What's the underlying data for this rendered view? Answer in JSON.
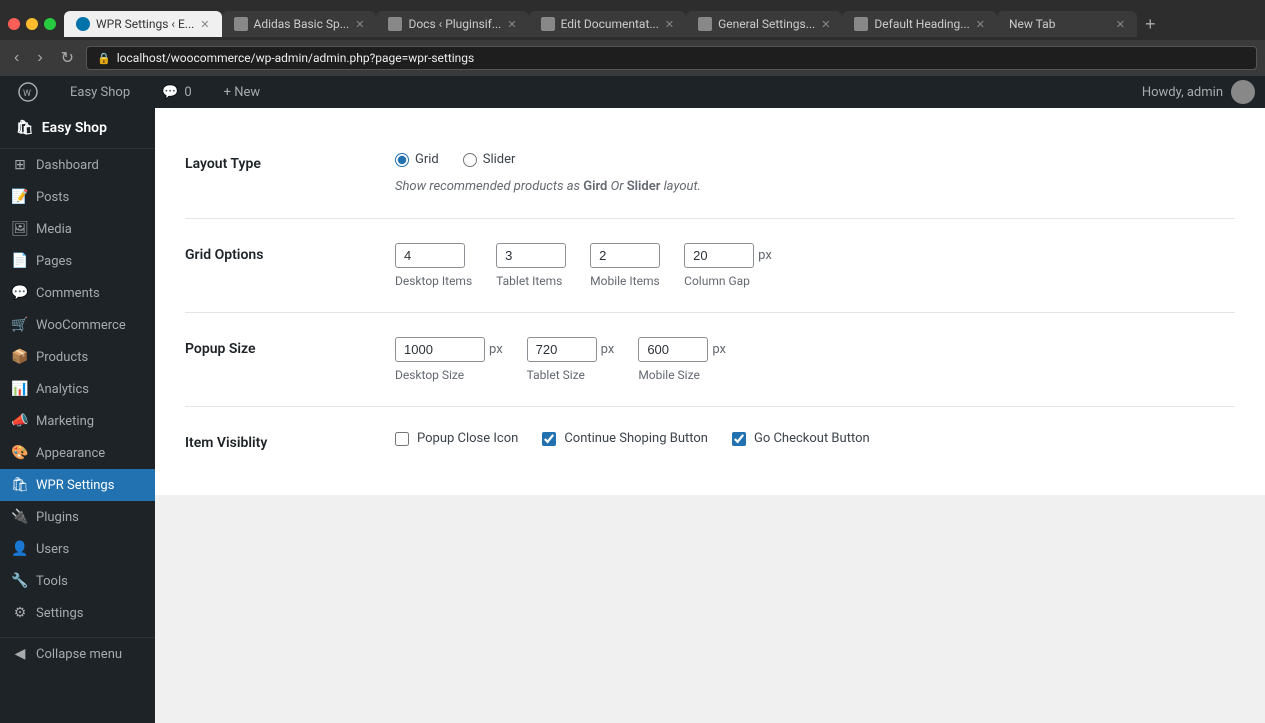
{
  "browser": {
    "tabs": [
      {
        "label": "WPR Settings ‹ E...",
        "active": true,
        "favicon": "wp"
      },
      {
        "label": "Adidas Basic Sp...",
        "active": false,
        "favicon": "web"
      },
      {
        "label": "Docs ‹ Pluginsif...",
        "active": false,
        "favicon": "web"
      },
      {
        "label": "Edit Documentat...",
        "active": false,
        "favicon": "web"
      },
      {
        "label": "General Settings...",
        "active": false,
        "favicon": "web"
      },
      {
        "label": "Default Heading...",
        "active": false,
        "favicon": "web"
      },
      {
        "label": "New Tab",
        "active": false,
        "favicon": "web"
      }
    ],
    "address": "localhost/woocommerce/wp-admin/admin.php?page=wpr-settings"
  },
  "admin_bar": {
    "wp_label": "🔘",
    "site_label": "Easy Shop",
    "comments_label": "💬",
    "comments_count": "0",
    "new_label": "+ New",
    "howdy": "Howdy, admin"
  },
  "sidebar": {
    "site_name": "Easy Shop",
    "items": [
      {
        "label": "Dashboard",
        "icon": "⊞"
      },
      {
        "label": "Posts",
        "icon": "📝"
      },
      {
        "label": "Media",
        "icon": "🖼"
      },
      {
        "label": "Pages",
        "icon": "📄"
      },
      {
        "label": "Comments",
        "icon": "💬"
      },
      {
        "label": "WooCommerce",
        "icon": "🛒"
      },
      {
        "label": "Products",
        "icon": "📦"
      },
      {
        "label": "Analytics",
        "icon": "📊"
      },
      {
        "label": "Marketing",
        "icon": "📣"
      },
      {
        "label": "Appearance",
        "icon": "🎨"
      },
      {
        "label": "WPR Settings",
        "icon": "🛍",
        "active": true
      },
      {
        "label": "Plugins",
        "icon": "🔌"
      },
      {
        "label": "Users",
        "icon": "👤"
      },
      {
        "label": "Tools",
        "icon": "🔧"
      },
      {
        "label": "Settings",
        "icon": "⚙"
      }
    ],
    "collapse_label": "Collapse menu"
  },
  "settings": {
    "layout_type": {
      "label": "Layout Type",
      "options": [
        "Grid",
        "Slider"
      ],
      "selected": "Grid",
      "help_text_before": "Show recommended products as ",
      "help_bold1": "Gird",
      "help_text_mid": " Or ",
      "help_bold2": "Slider",
      "help_text_after": " layout."
    },
    "grid_options": {
      "label": "Grid Options",
      "desktop_items_value": "4",
      "desktop_items_label": "Desktop Items",
      "tablet_items_value": "3",
      "tablet_items_label": "Tablet Items",
      "mobile_items_value": "2",
      "mobile_items_label": "Mobile Items",
      "column_gap_value": "20",
      "column_gap_label": "Column Gap",
      "column_gap_suffix": "px"
    },
    "popup_size": {
      "label": "Popup Size",
      "desktop_value": "1000",
      "desktop_label": "Desktop Size",
      "desktop_suffix": "px",
      "tablet_value": "720",
      "tablet_label": "Tablet Size",
      "tablet_suffix": "px",
      "mobile_value": "600",
      "mobile_label": "Mobile Size",
      "mobile_suffix": "px"
    },
    "item_visibility": {
      "label": "Item Visiblity",
      "popup_close_icon_label": "Popup Close Icon",
      "popup_close_icon_checked": false,
      "continue_shopping_label": "Continue Shoping Button",
      "continue_shopping_checked": true,
      "go_checkout_label": "Go Checkout Button",
      "go_checkout_checked": true
    }
  }
}
